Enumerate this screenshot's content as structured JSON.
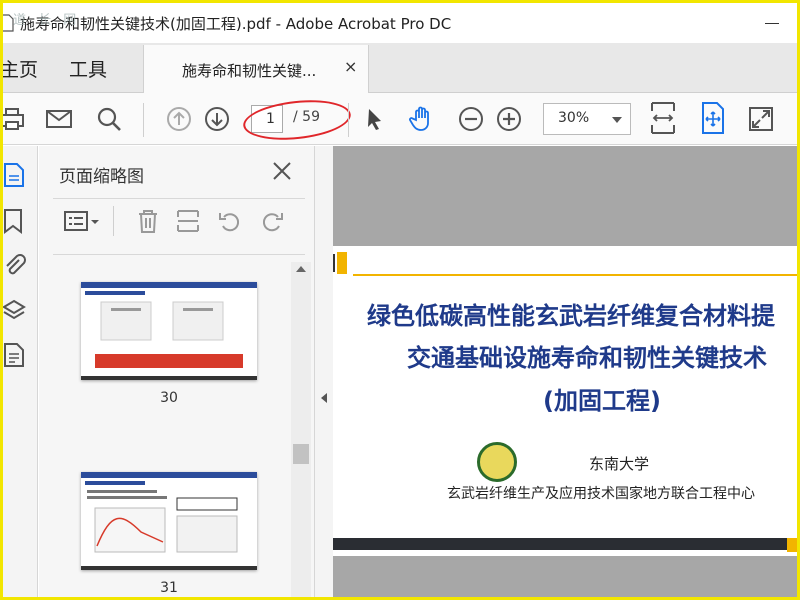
{
  "window": {
    "title": "施寿命和韧性关键技术(加固工程).pdf - Adobe Acrobat Pro DC",
    "watermark": "道 长 网"
  },
  "menus": {
    "home": "主页",
    "tools": "工具"
  },
  "doc_tab": {
    "label": "施寿命和韧性关键...",
    "close": "×"
  },
  "toolbar": {
    "page_current": "1",
    "page_total": "/ 59",
    "zoom": "30%"
  },
  "thumbnail_panel": {
    "title": "页面缩略图",
    "thumbnails": [
      {
        "page": "30"
      },
      {
        "page": "31"
      }
    ]
  },
  "document_page": {
    "title_line1": "绿色低碳高性能玄武岩纤维复合材料提",
    "title_line2": "交通基础设施寿命和韧性关键技术",
    "title_line3": "(加固工程)",
    "org1": "东南大学",
    "org2": "玄武岩纤维生产及应用技术国家地方联合工程中心"
  },
  "colors": {
    "frame_yellow": "#f2e600",
    "title_blue": "#1f3a8a",
    "accent_blue": "#1a73e8",
    "annotation_red": "#e0262a",
    "accent_gold": "#f2b400"
  }
}
